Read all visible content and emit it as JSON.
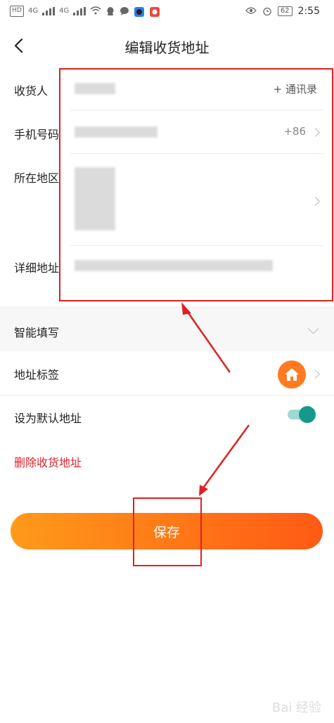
{
  "status_bar": {
    "hd": "HD",
    "signal1": "4G",
    "signal2": "4G",
    "battery": "62",
    "time": "2:55"
  },
  "header": {
    "title": "编辑收货地址"
  },
  "form": {
    "recipient_label": "收货人",
    "contacts_link": "+ 通讯录",
    "phone_label": "手机号码",
    "phone_prefix": "+86",
    "region_label": "所在地区",
    "address_label": "详细地址"
  },
  "options": {
    "smart_fill_label": "智能填写",
    "address_tag_label": "地址标签",
    "default_label": "设为默认地址",
    "default_enabled": true,
    "delete_label": "删除收货地址"
  },
  "actions": {
    "save_label": "保存"
  },
  "colors": {
    "accent_start": "#ff9a1a",
    "accent_end": "#ff5a14",
    "toggle_on": "#16998a",
    "delete": "#e0242b",
    "annotation": "#e02020"
  },
  "watermark": "Bai 经验"
}
